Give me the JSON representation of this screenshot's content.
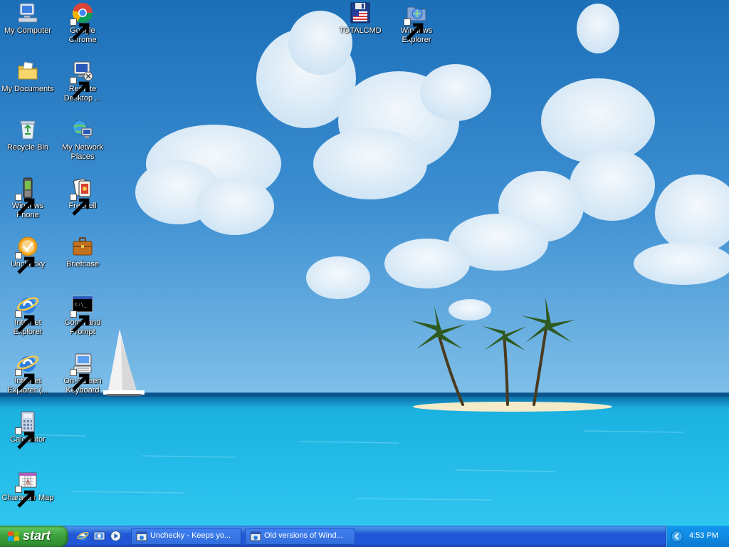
{
  "desktop": {
    "icons": [
      {
        "id": "my-computer",
        "label": "My Computer",
        "icon": "my-computer-icon"
      },
      {
        "id": "google-chrome",
        "label": "Google Chrome",
        "icon": "chrome-icon"
      },
      {
        "id": "my-documents",
        "label": "My Documents",
        "icon": "folder-icon"
      },
      {
        "id": "remote-desktop",
        "label": "Remote Desktop ...",
        "icon": "remote-desktop-icon"
      },
      {
        "id": "recycle-bin",
        "label": "Recycle Bin",
        "icon": "recycle-bin-icon"
      },
      {
        "id": "my-network-places",
        "label": "My Network Places",
        "icon": "network-icon"
      },
      {
        "id": "windows-phone",
        "label": "Windows Phone",
        "icon": "phone-icon"
      },
      {
        "id": "freecell",
        "label": "Freecell",
        "icon": "cards-icon"
      },
      {
        "id": "unchecky",
        "label": "Unchecky",
        "icon": "unchecky-icon"
      },
      {
        "id": "briefcase",
        "label": "Briefcase",
        "icon": "briefcase-icon"
      },
      {
        "id": "internet-explorer",
        "label": "Internet Explorer",
        "icon": "ie-icon"
      },
      {
        "id": "command-prompt",
        "label": "Command Prompt",
        "icon": "command-prompt-icon"
      },
      {
        "id": "internet-explorer-2",
        "label": "Internet Explorer (...",
        "icon": "ie-icon"
      },
      {
        "id": "on-screen-keyboard",
        "label": "On-Screen Keyboard",
        "icon": "keyboard-icon"
      },
      {
        "id": "calculator",
        "label": "Calculator",
        "icon": "calculator-icon"
      },
      {
        "id": "character-map",
        "label": "Character Map",
        "icon": "character-map-icon"
      },
      {
        "id": "totalcmd",
        "label": "TOTALCMD",
        "icon": "floppy-icon"
      },
      {
        "id": "windows-explorer",
        "label": "Windows Explorer",
        "icon": "explorer-icon"
      }
    ]
  },
  "taskbar": {
    "start_label": "start",
    "quick_launch": [
      {
        "name": "ie-quicklaunch",
        "icon": "ie-icon"
      },
      {
        "name": "show-desktop",
        "icon": "show-desktop-icon"
      },
      {
        "name": "media-player",
        "icon": "media-player-icon"
      }
    ],
    "tasks": [
      {
        "label": "Unchecky - Keeps yo...",
        "icon": "ie-window-icon"
      },
      {
        "label": "Old versions of Wind...",
        "icon": "ie-window-icon"
      }
    ],
    "clock": "4:53 PM"
  },
  "colors": {
    "taskbar_blue": "#2157d7",
    "start_green": "#3a9f3a",
    "tray_blue": "#0f8be3"
  }
}
